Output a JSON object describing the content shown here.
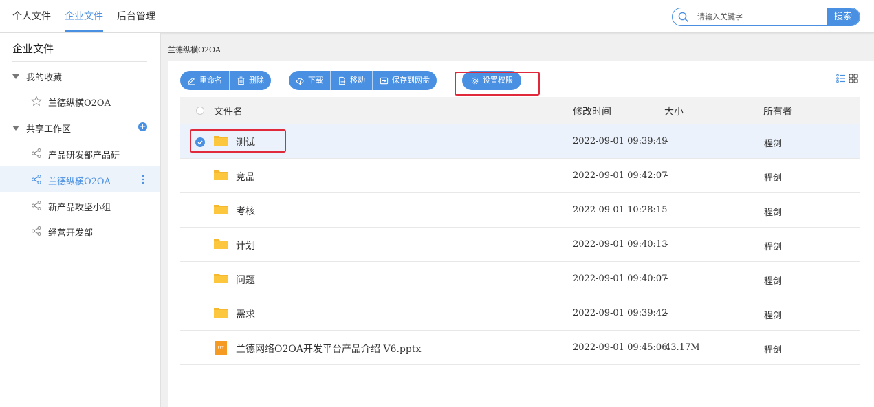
{
  "topnav": {
    "tabs": [
      {
        "label": "个人文件"
      },
      {
        "label": "企业文件"
      },
      {
        "label": "后台管理"
      }
    ],
    "active_index": 1
  },
  "search": {
    "placeholder": "请输入关键字",
    "button_label": "搜索"
  },
  "sidebar": {
    "title": "企业文件",
    "favorites": {
      "label": "我的收藏",
      "items": [
        {
          "label": "兰德纵横O2OA"
        }
      ]
    },
    "shared": {
      "label": "共享工作区",
      "items": [
        {
          "label": "产品研发部产品研"
        },
        {
          "label": "兰德纵横O2OA"
        },
        {
          "label": "新产品攻坚小组"
        },
        {
          "label": "经营开发部"
        }
      ],
      "active_index": 1
    }
  },
  "breadcrumb": "兰德纵横O2OA",
  "toolbar": {
    "rename": "重命名",
    "delete": "删除",
    "download": "下载",
    "move": "移动",
    "save_to_disk": "保存到网盘",
    "set_permission": "设置权限"
  },
  "table": {
    "headers": {
      "name": "文件名",
      "modified": "修改时间",
      "size": "大小",
      "owner": "所有者"
    },
    "rows": [
      {
        "type": "folder",
        "name": "测试",
        "modified": "2022-09-01 09:39:49",
        "size": "-",
        "owner": "程剑",
        "selected": true
      },
      {
        "type": "folder",
        "name": "竞品",
        "modified": "2022-09-01 09:42:07",
        "size": "-",
        "owner": "程剑"
      },
      {
        "type": "folder",
        "name": "考核",
        "modified": "2022-09-01 10:28:15",
        "size": "-",
        "owner": "程剑"
      },
      {
        "type": "folder",
        "name": "计划",
        "modified": "2022-09-01 09:40:13",
        "size": "-",
        "owner": "程剑"
      },
      {
        "type": "folder",
        "name": "问题",
        "modified": "2022-09-01 09:40:07",
        "size": "-",
        "owner": "程剑"
      },
      {
        "type": "folder",
        "name": "需求",
        "modified": "2022-09-01 09:39:42",
        "size": "-",
        "owner": "程剑"
      },
      {
        "type": "ppt",
        "badge": "PPT",
        "name": "兰德网络O2OA开发平台产品介绍 V6.pptx",
        "modified": "2022-09-01 09:45:06",
        "size": "43.17M",
        "owner": "程剑"
      }
    ]
  },
  "colors": {
    "accent": "#4a90e2",
    "highlight": "#e0293a",
    "folder": "#f5b82e",
    "ppt": "#f59a23"
  }
}
